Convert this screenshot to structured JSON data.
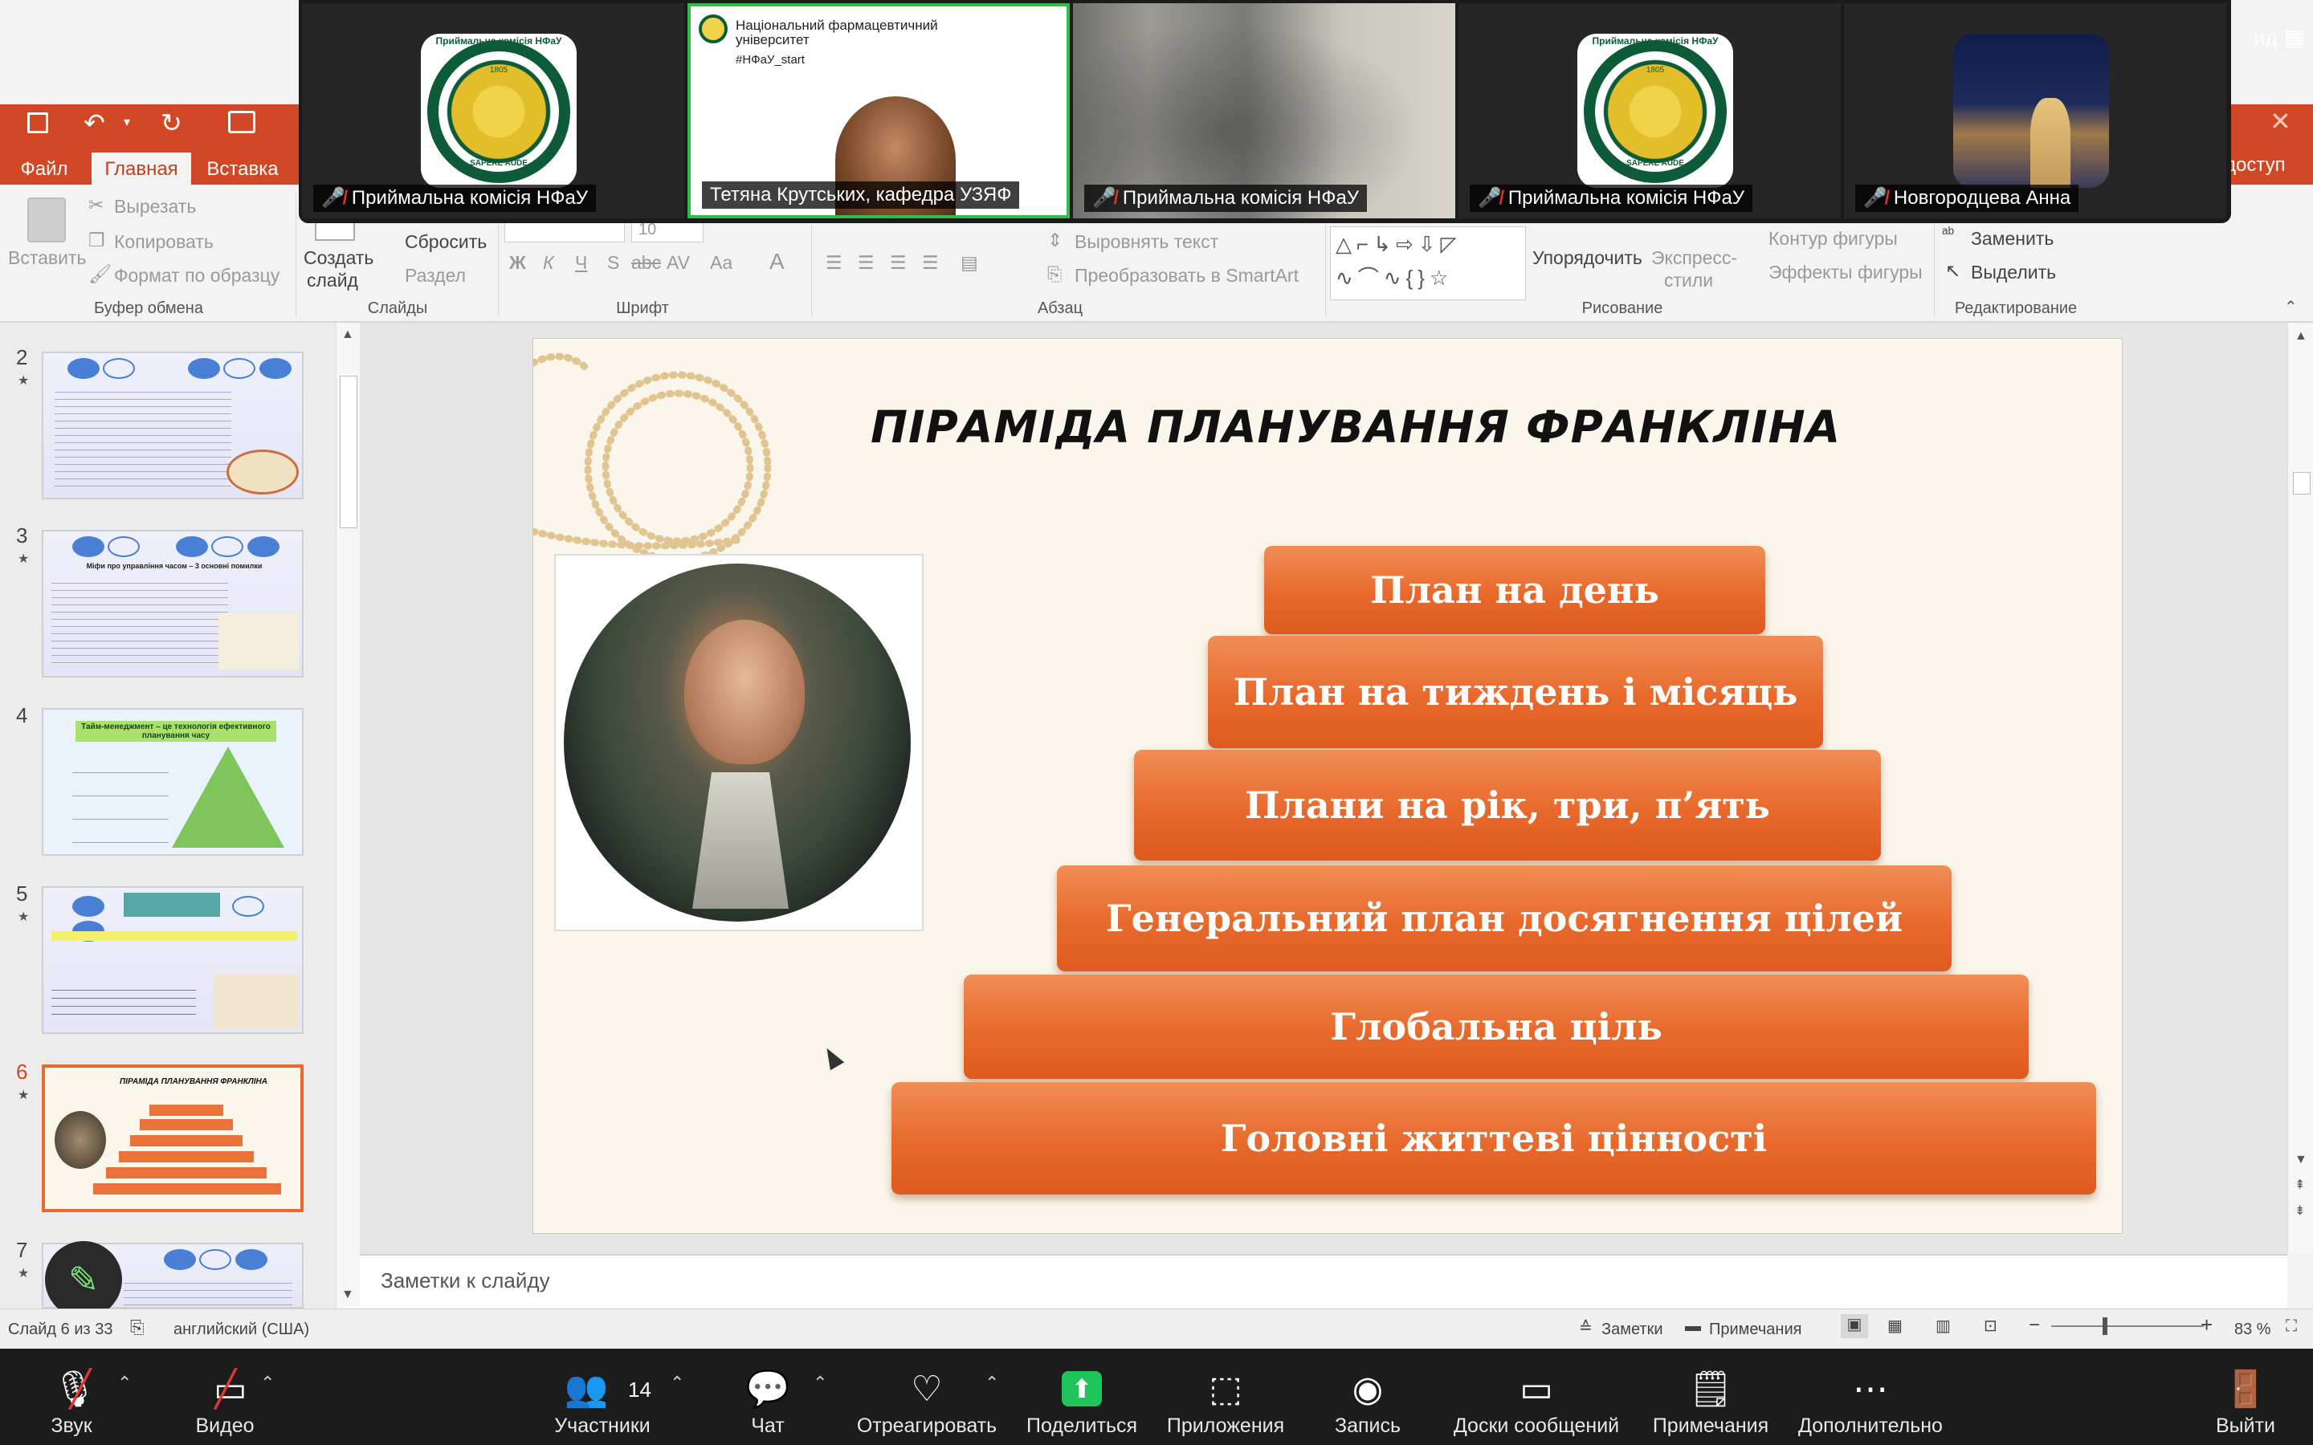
{
  "ppt": {
    "tabs": [
      "Файл",
      "Главная",
      "Вставка"
    ],
    "active_tab": "Главная",
    "right_label": "доступ",
    "ribbon": {
      "clipboard": {
        "paste": "Вставить",
        "cut": "Вырезать",
        "copy": "Копировать",
        "format_painter": "Формат по образцу",
        "group": "Буфер обмена"
      },
      "slides": {
        "new_slide_1": "Создать",
        "new_slide_2": "слайд",
        "reset": "Сбросить",
        "section": "Раздел",
        "group": "Слайды"
      },
      "font": {
        "group": "Шрифт",
        "size": "10",
        "bold": "Ж",
        "italic": "К",
        "underline": "Ч",
        "shadow": "S",
        "strike": "abc",
        "spacing": "AV",
        "case": "Aa",
        "color": "A"
      },
      "paragraph": {
        "align_text": "Выровнять текст",
        "smartart": "Преобразовать в SmartArt",
        "group": "Абзац"
      },
      "drawing": {
        "arrange": "Упорядочить",
        "quick_styles_1": "Экспресс-",
        "quick_styles_2": "стили",
        "shape_outline": "Контур фигуры",
        "shape_effects": "Эффекты фигуры",
        "group": "Рисование"
      },
      "editing": {
        "replace": "Заменить",
        "select": "Выделить",
        "group": "Редактирование"
      }
    },
    "thumbnails": [
      {
        "num": "2"
      },
      {
        "num": "3",
        "title": "Міфи про управління часом – 3 основні помилки"
      },
      {
        "num": "4",
        "title": "Тайм-менеджмент – це технологія ефективного планування часу"
      },
      {
        "num": "5"
      },
      {
        "num": "6",
        "title": "ПІРАМІДА ПЛАНУВАННЯ ФРАНКЛІНА"
      },
      {
        "num": "7"
      }
    ],
    "slide": {
      "title": "ПІРАМІДА ПЛАНУВАННЯ ФРАНКЛІНА",
      "levels": [
        "План на день",
        "План на тиждень і місяць",
        "Плани на рік, три, п’ять",
        "Генеральний план досягнення цілей",
        "Глобальна ціль",
        "Головні життеві цінності"
      ]
    },
    "notes_placeholder": "Заметки к слайду",
    "status": {
      "slide_of": "Слайд 6 из 33",
      "language": "английский (США)",
      "notes": "Заметки",
      "comments": "Примечания",
      "zoom": "83 %"
    }
  },
  "zoom": {
    "top_right": "ид",
    "participants": [
      {
        "name": "Приймальна комісія НФаУ",
        "type": "logo"
      },
      {
        "name": "Тетяна Крутських, кафедра УЗЯФ",
        "type": "video",
        "active": true,
        "org_line1": "Національний фармацевтичний",
        "org_line2": "університет",
        "hashtag": "#НФаУ_start"
      },
      {
        "name": "Приймальна комісія НФаУ",
        "type": "blur"
      },
      {
        "name": "Приймальна комісія НФаУ",
        "type": "logo"
      },
      {
        "name": "Новгородцева Анна",
        "type": "photo"
      }
    ],
    "logo_text": "Приймальна комісія НФаУ",
    "logo_year": "1805",
    "logo_motto": "SAPERE AUDE",
    "toolbar": {
      "audio": "Звук",
      "video": "Видео",
      "participants": "Участники",
      "participants_count": "14",
      "chat": "Чат",
      "react": "Отреагировать",
      "share": "Поделиться",
      "apps": "Приложения",
      "record": "Запись",
      "whiteboards": "Доски сообщений",
      "notes": "Примечания",
      "more": "Дополнительно",
      "leave": "Выйти"
    }
  },
  "colors": {
    "ppt_red": "#d24726",
    "accent_orange": "#e8692c",
    "active_green": "#2dbe4a",
    "zoom_bg": "#1c1c1c"
  }
}
